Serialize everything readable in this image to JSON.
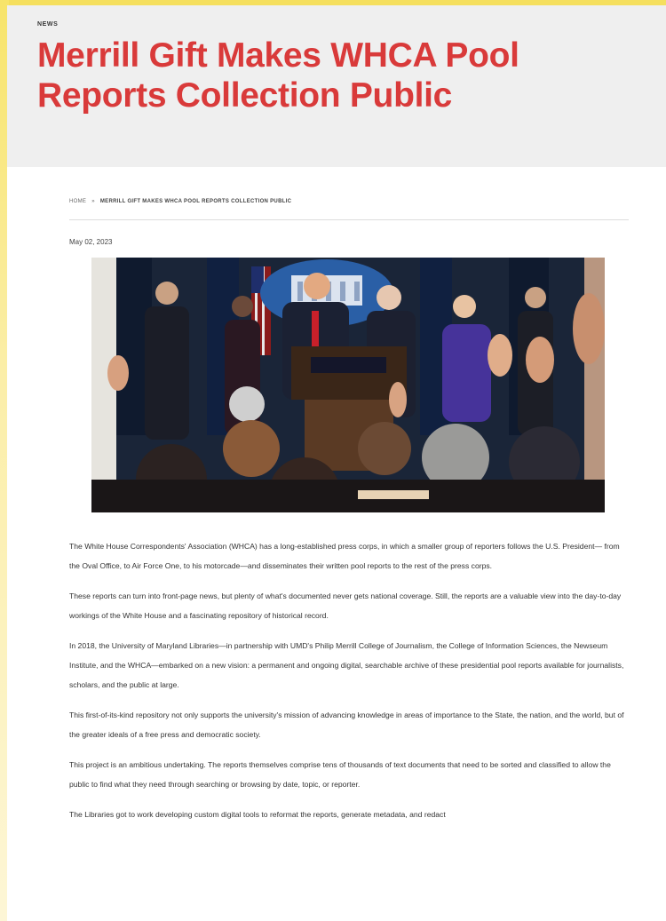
{
  "header": {
    "category": "NEWS",
    "title": "Merrill Gift Makes WHCA Pool Reports Collection Public"
  },
  "breadcrumb": {
    "home": "HOME",
    "separator": "»",
    "current": "MERRILL GIFT MAKES WHCA POOL REPORTS COLLECTION PUBLIC"
  },
  "article": {
    "date": "May 02, 2023",
    "image_alt": "Press briefing at the White House",
    "paragraphs": [
      "The White House Correspondents' Association (WHCA) has a long-established press corps, in which a smaller group of reporters follows the U.S. President— from the Oval Office, to Air Force One, to his motorcade—and disseminates their written pool reports to the rest of the press corps.",
      "These reports can turn into front-page news, but plenty of what's documented never gets national coverage. Still, the reports are a valuable view into the day-to-day workings of the White House and a fascinating repository of historical record.",
      "In 2018, the University of Maryland Libraries—in partnership with UMD's Philip Merrill College of Journalism, the College of Information Sciences, the Newseum Institute, and the WHCA—embarked on a new vision: a permanent and ongoing digital, searchable archive of these presidential pool reports available for journalists, scholars, and the public at large.",
      "This first-of-its-kind repository not only supports the university's mission of advancing knowledge in areas of importance to the State, the nation, and the world, but of the greater ideals of a free press and democratic society.",
      "This project is an ambitious undertaking. The reports themselves comprise tens of thousands of text documents that need to be sorted and classified to allow the public to find what they need through searching or browsing by date, topic, or reporter.",
      "The Libraries got to work developing custom digital tools to reformat the reports, generate metadata, and redact"
    ]
  },
  "colors": {
    "title": "#d93a3a",
    "hero_background": "#efefef",
    "page_edge": "#f5df5e"
  }
}
